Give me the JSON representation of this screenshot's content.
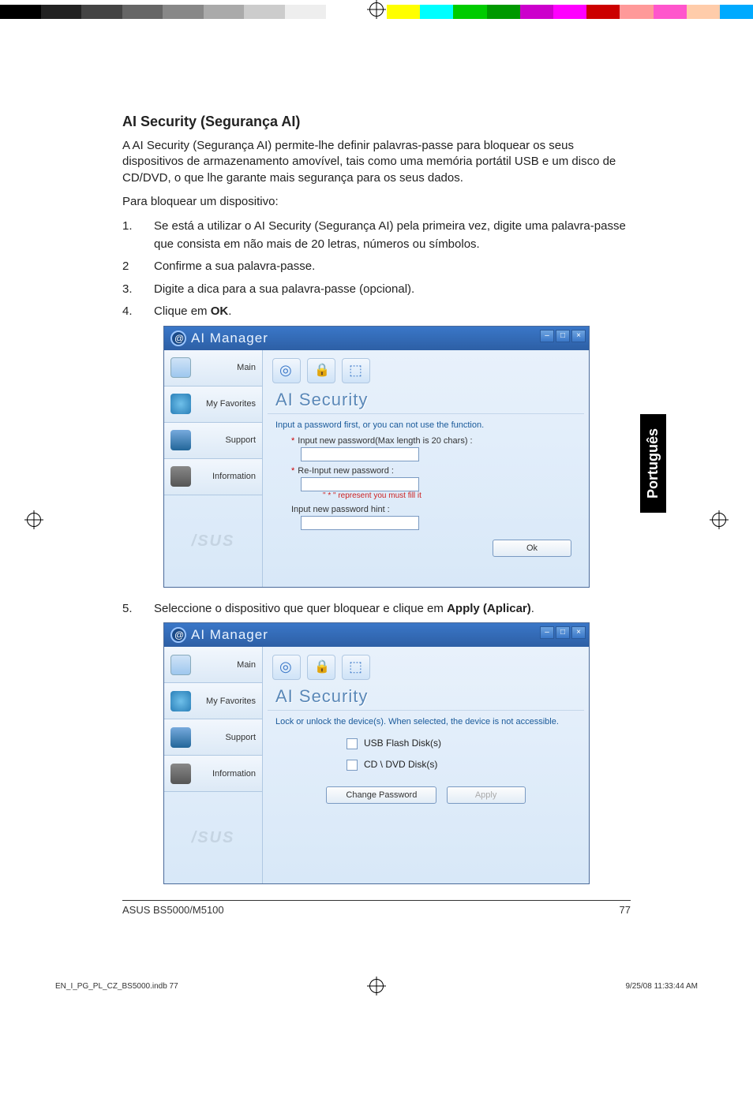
{
  "colorbar_left": [
    "#000",
    "#222",
    "#444",
    "#666",
    "#888",
    "#aaa",
    "#ccc",
    "#eee",
    "#fff"
  ],
  "colorbar_right": [
    "#ff0",
    "#0ff",
    "#0c0",
    "#090",
    "#c0c",
    "#f0f",
    "#c00",
    "#f99",
    "#f5c",
    "#fca",
    "#0af"
  ],
  "lang_tab": "Português",
  "heading": "AI Security (Segurança AI)",
  "intro": "A AI Security (Segurança AI) permite-lhe definir palavras-passe para bloquear os seus dispositivos de armazenamento amovível, tais como uma memória portátil USB e um disco de CD/DVD, o que lhe garante mais segurança para os seus dados.",
  "lead": "Para bloquear um dispositivo:",
  "steps_a": [
    {
      "n": "1.",
      "t": "Se está a utilizar o AI Security (Segurança AI) pela primeira vez, digite uma palavra-passe que consista em não mais de 20 letras, números ou símbolos."
    },
    {
      "n": "2",
      "t": "Confirme a sua palavra-passe."
    },
    {
      "n": "3.",
      "t": "Digite a dica para a sua palavra-passe (opcional)."
    },
    {
      "n": "4.",
      "t": "Clique em OK."
    }
  ],
  "step_bold_ok": "OK",
  "step5": {
    "n": "5.",
    "pre": "Seleccione o dispositivo que quer bloquear e clique em ",
    "bold": "Apply (Aplicar)",
    "post": "."
  },
  "app": {
    "title": "AI Manager",
    "winbtns": {
      "min": "–",
      "max": "□",
      "close": "×"
    },
    "sidebar": {
      "main": "Main",
      "fav": "My Favorites",
      "support": "Support",
      "info": "Information",
      "brand": "/SUS"
    },
    "panel_title": "AI Security"
  },
  "screen1": {
    "subtitle": "Input a password first, or you can not use the function.",
    "label_new": "Input new password(Max length is 20 chars) :",
    "label_re": "Re-Input new password :",
    "hint_red": "\" * \" represent you must fill it",
    "label_hint": "Input new password hint :",
    "ok_btn": "Ok"
  },
  "screen2": {
    "subtitle": "Lock or unlock the device(s). When selected, the device is not accessible.",
    "opt_usb": "USB Flash Disk(s)",
    "opt_cd": "CD \\ DVD Disk(s)",
    "change_btn": "Change Password",
    "apply_btn": "Apply"
  },
  "footer": {
    "left": "ASUS BS5000/M5100",
    "right": "77"
  },
  "printfoot": {
    "file": "EN_I_PG_PL_CZ_BS5000.indb   77",
    "stamp": "9/25/08   11:33:44 AM"
  }
}
